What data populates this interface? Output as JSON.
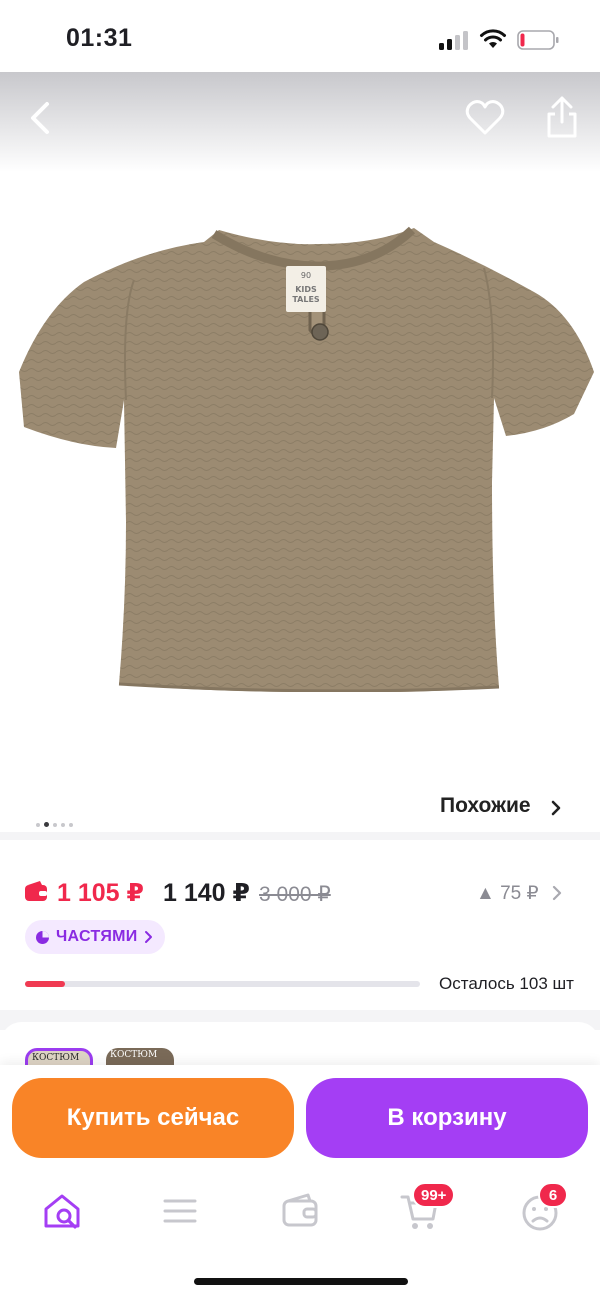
{
  "status": {
    "time": "01:31",
    "battery_color": "#f0284c"
  },
  "nav": {
    "back_icon": "chevron-left-icon",
    "favorite_icon": "heart-icon",
    "share_icon": "share-icon"
  },
  "gallery": {
    "total_images": 5,
    "active_index": 1,
    "similar_label": "Похожие"
  },
  "product_label": {
    "size": "90",
    "brand_line1": "KIDS",
    "brand_line2": "TALES"
  },
  "pricing": {
    "card_price": "1 105 ₽",
    "price": "1 140 ₽",
    "old_price": "3 000 ₽",
    "price_change": "▲ 75 ₽",
    "installments_label": "ЧАСТЯМИ",
    "stock_fraction": 0.1,
    "stock_label": "Осталось 103 шт"
  },
  "variants": [
    {
      "label": "КОСТЮМ",
      "selected": true
    },
    {
      "label": "КОСТЮМ",
      "selected": false
    }
  ],
  "actions": {
    "buy_now": "Купить сейчас",
    "add_to_cart": "В корзину"
  },
  "tabbar": {
    "home_icon": "home-search-icon",
    "catalog_icon": "menu-icon",
    "wallet_icon": "wallet-icon",
    "cart_icon": "cart-icon",
    "cart_badge": "99+",
    "profile_icon": "profile-icon",
    "profile_badge": "6"
  },
  "colors": {
    "accent_purple": "#a43ef4",
    "accent_orange": "#f98427",
    "price_red": "#f0284c"
  }
}
